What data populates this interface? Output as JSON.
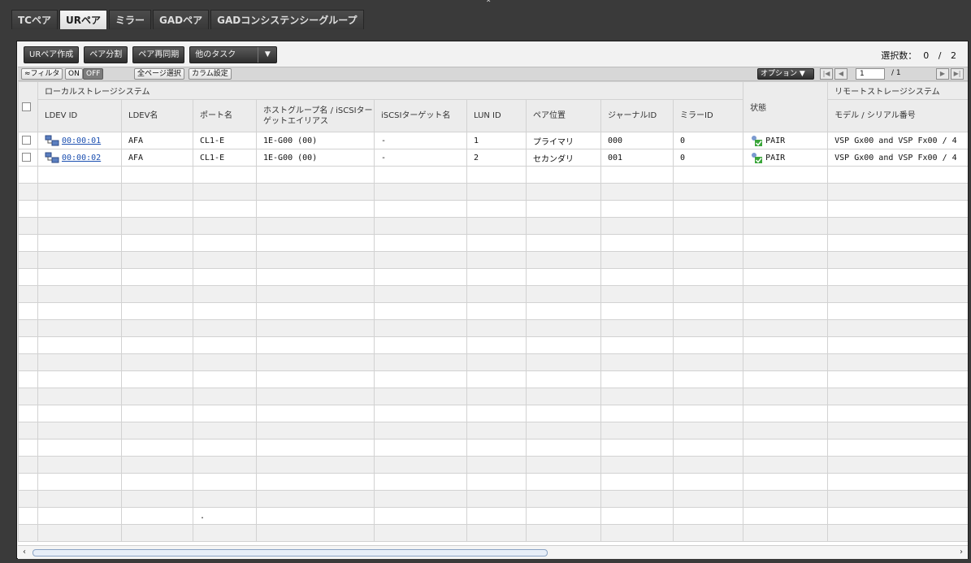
{
  "tabs": [
    "TCペア",
    "URペア",
    "ミラー",
    "GADペア",
    "GADコンシステンシーグループ"
  ],
  "active_tab": "URペア",
  "toolbar": {
    "create": "URペア作成",
    "split": "ペア分割",
    "resync": "ペア再同期",
    "other_tasks": "他のタスク"
  },
  "selection": {
    "label": "選択数：",
    "count": "0",
    "separator": "/",
    "total": "2"
  },
  "filterbar": {
    "filter": "フィルタ",
    "on": "ON",
    "off": "OFF",
    "select_all_pages": "全ページ選択",
    "column_settings": "カラム設定",
    "options": "オプション",
    "page": "1",
    "page_total": "/ 1"
  },
  "table": {
    "group_local": "ローカルストレージシステム",
    "group_remote": "リモートストレージシステム",
    "headers": {
      "ldev_id": "LDEV ID",
      "ldev_name": "LDEV名",
      "port": "ポート名",
      "host_group": "ホストグループ名 / iSCSIターゲットエイリアス",
      "iscsi_target": "iSCSIターゲット名",
      "lun_id": "LUN ID",
      "pair_position": "ペア位置",
      "journal_id": "ジャーナルID",
      "mirror_id": "ミラーID",
      "status": "状態",
      "model_serial": "モデル / シリアル番号"
    },
    "rows": [
      {
        "ldev_id": "00:00:01",
        "ldev_name": "AFA",
        "port": "CL1-E",
        "host_group": "1E-G00 (00)",
        "iscsi_target": "-",
        "lun_id": "1",
        "pair_position": "プライマリ",
        "journal_id": "000",
        "mirror_id": "0",
        "status": "PAIR",
        "model_serial": "VSP Gx00 and VSP Fx00 / 4"
      },
      {
        "ldev_id": "00:00:02",
        "ldev_name": "AFA",
        "port": "CL1-E",
        "host_group": "1E-G00 (00)",
        "iscsi_target": "-",
        "lun_id": "2",
        "pair_position": "セカンダリ",
        "journal_id": "001",
        "mirror_id": "0",
        "status": "PAIR",
        "model_serial": "VSP Gx00 and VSP Fx00 / 4"
      }
    ],
    "stray_mark": "."
  },
  "colors": {
    "link": "#1b4fb0",
    "status_ok": "#3aa63a"
  },
  "icons": [
    "ldev-icon",
    "pair-status-icon",
    "filter-toggle-icon",
    "dropdown-arrow-icon",
    "scroll-left-icon",
    "scroll-right-icon"
  ]
}
